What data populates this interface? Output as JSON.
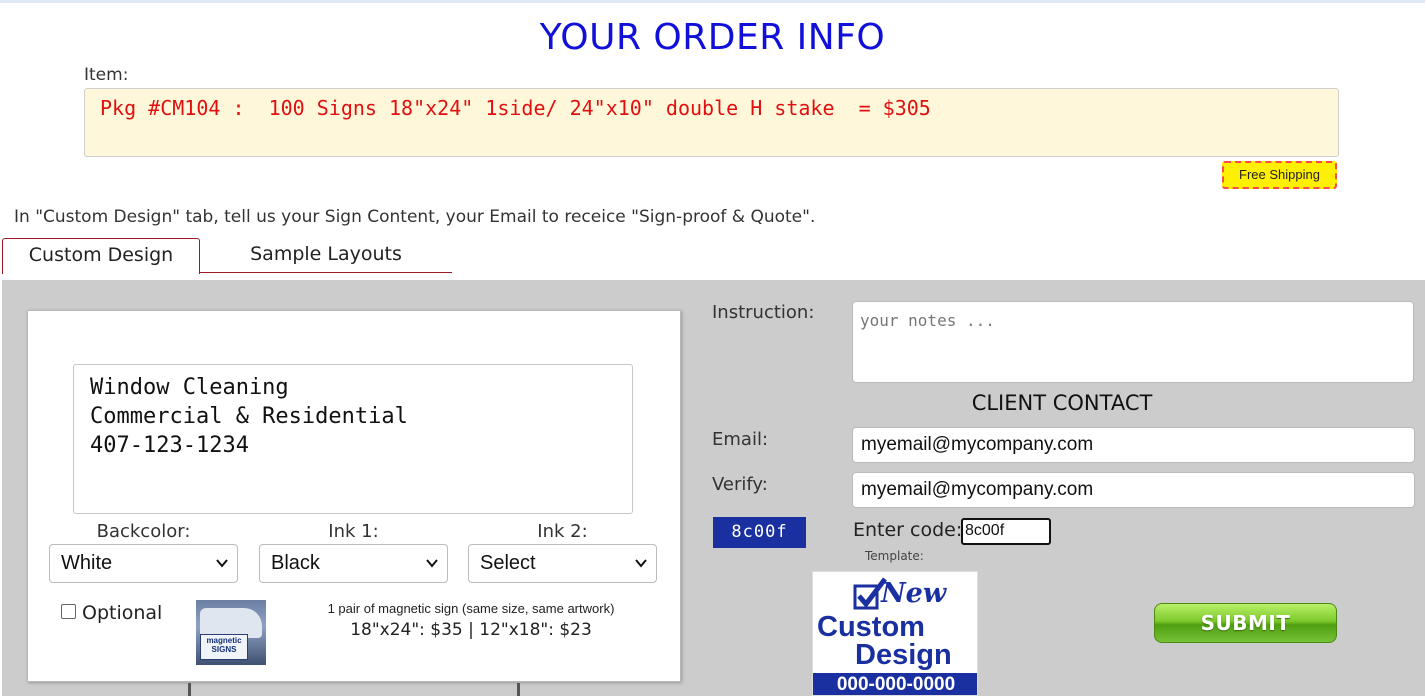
{
  "page": {
    "title": "YOUR ORDER INFO",
    "item_label": "Item:",
    "item_value": "Pkg #CM104 :  100 Signs 18\"x24\" 1side/ 24\"x10\" double H stake  = $305",
    "free_shipping_badge": "Free Shipping",
    "instructions": "In \"Custom Design\" tab, tell us your Sign Content, your Email to receice \"Sign-proof & Quote\"."
  },
  "tabs": [
    {
      "label": "Custom Design",
      "active": true
    },
    {
      "label": "Sample Layouts",
      "active": false
    }
  ],
  "design": {
    "sign_content": "Window Cleaning\nCommercial & Residential\n407-123-1234",
    "backcolor_label": "Backcolor:",
    "backcolor_value": "White",
    "ink1_label": "Ink 1:",
    "ink1_value": "Black",
    "ink2_label": "Ink 2:",
    "ink2_value": "Select",
    "optional_label": "Optional",
    "optional_checked": false,
    "magnetic_image_text": "magnetic SIGNS",
    "magnetic_desc": "1 pair of magnetic sign (same size, same artwork)",
    "magnetic_prices": "18\"x24\": $35 | 12\"x18\": $23"
  },
  "contact": {
    "instruction_label": "Instruction:",
    "notes_placeholder": "your notes ...",
    "client_contact_heading": "CLIENT CONTACT",
    "email_label": "Email:",
    "email_value": "myemail@mycompany.com",
    "verify_label": "Verify:",
    "verify_value": "myemail@mycompany.com",
    "captcha_code": "8c00f",
    "enter_code_label": "Enter code:",
    "enter_code_value": "8c00f",
    "template_label": "Template:",
    "template_image": {
      "line1": "New",
      "line2": "Custom",
      "line3": "Design",
      "phone": "000-000-0000"
    },
    "submit_label": "SUBMIT"
  },
  "colors": {
    "title": "#1010d8",
    "item_text": "#e01010",
    "item_background": "#fff7d9",
    "panel_background": "#cccccc",
    "captcha_background": "#1a2fa0",
    "submit_green": "#7cc92a",
    "badge_yellow": "#ffef00"
  },
  "icons": {
    "select_chevron": "chevron-down-icon",
    "template_check": "checkmark-icon"
  }
}
